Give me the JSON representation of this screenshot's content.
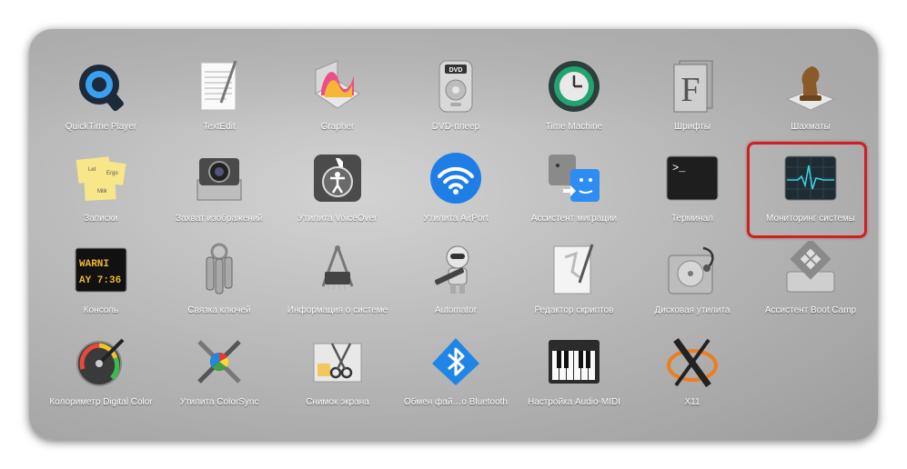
{
  "launchpad": {
    "apps": [
      {
        "label": "QuickTime Player",
        "icon": "quicktime-icon"
      },
      {
        "label": "TextEdit",
        "icon": "textedit-icon"
      },
      {
        "label": "Grapher",
        "icon": "grapher-icon"
      },
      {
        "label": "DVD-плеер",
        "icon": "dvd-player-icon"
      },
      {
        "label": "Time Machine",
        "icon": "time-machine-icon"
      },
      {
        "label": "Шрифты",
        "icon": "fonts-icon"
      },
      {
        "label": "Шахматы",
        "icon": "chess-icon"
      },
      {
        "label": "Записки",
        "icon": "stickies-icon",
        "note_text": [
          "Let",
          "Ergo",
          "Milk"
        ]
      },
      {
        "label": "Захват изображений",
        "icon": "image-capture-icon"
      },
      {
        "label": "Утилита VoiceOver",
        "icon": "voiceover-icon"
      },
      {
        "label": "Утилита AirPort",
        "icon": "airport-icon"
      },
      {
        "label": "Ассистент миграции",
        "icon": "migration-icon"
      },
      {
        "label": "Терминал",
        "icon": "terminal-icon",
        "prompt": ">_"
      },
      {
        "label": "Мониторинг системы",
        "icon": "activity-monitor-icon",
        "highlighted": true
      },
      {
        "label": "Консоль",
        "icon": "console-icon",
        "screen_text": [
          "WARNI",
          "AY 7:36"
        ]
      },
      {
        "label": "Связка ключей",
        "icon": "keychain-icon"
      },
      {
        "label": "Информация о системе",
        "icon": "system-info-icon"
      },
      {
        "label": "Automator",
        "icon": "automator-icon"
      },
      {
        "label": "Редактор скриптов",
        "icon": "script-editor-icon"
      },
      {
        "label": "Дисковая утилита",
        "icon": "disk-utility-icon"
      },
      {
        "label": "Ассистент Boot Camp",
        "icon": "bootcamp-icon"
      },
      {
        "label": "Колориметр Digital Color",
        "icon": "digital-color-meter-icon"
      },
      {
        "label": "Утилита ColorSync",
        "icon": "colorsync-icon"
      },
      {
        "label": "Снимок экрана",
        "icon": "screenshot-icon"
      },
      {
        "label": "Обмен фай…о Bluetooth",
        "icon": "bluetooth-icon"
      },
      {
        "label": "Настройка Audio-MIDI",
        "icon": "audio-midi-icon"
      },
      {
        "label": "X11",
        "icon": "x11-icon"
      }
    ]
  },
  "colors": {
    "highlight": "#d01e22",
    "label": "#ffffff"
  }
}
